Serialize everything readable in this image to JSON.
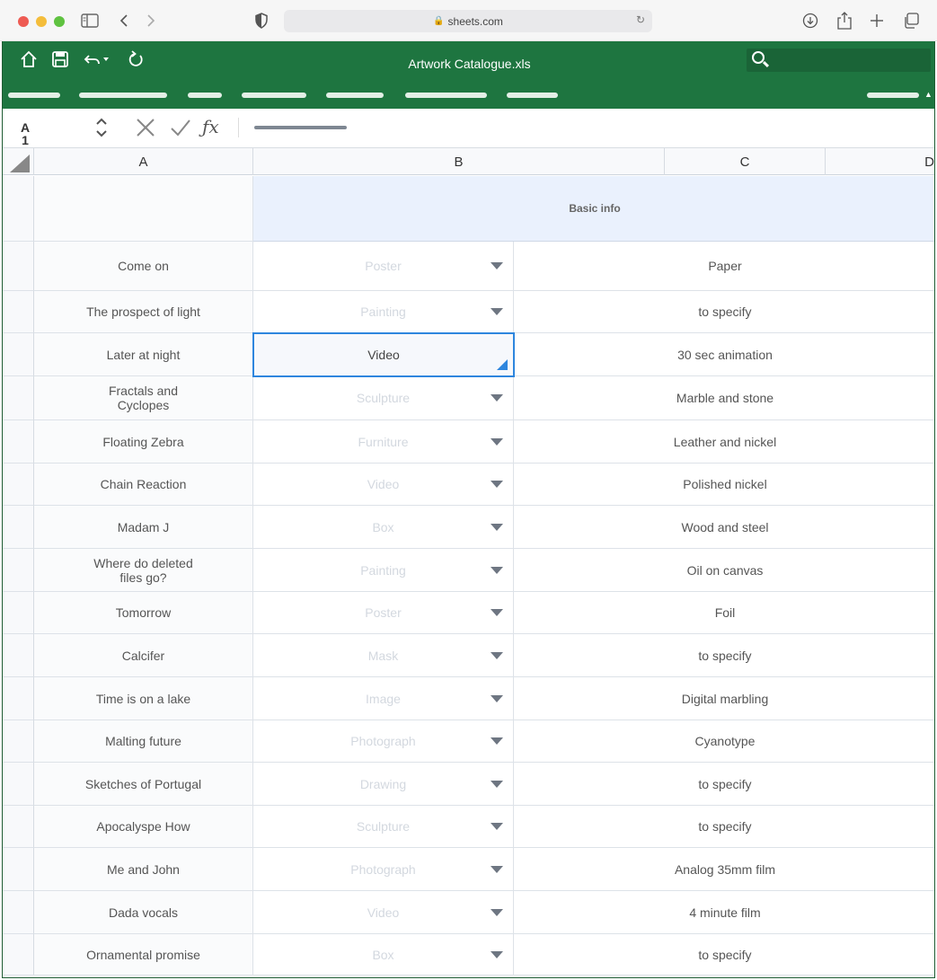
{
  "browser": {
    "url": "sheets.com"
  },
  "app": {
    "title": "Artwork Catalogue.xls",
    "selected_cell": "A1",
    "selected_cell_col": "A",
    "selected_cell_row": "1",
    "accent_color": "#1e7540",
    "selection_color": "#2e86de"
  },
  "columns": [
    "A",
    "B",
    "C",
    "D"
  ],
  "group_header": "Basic info",
  "rows": [
    {
      "title": "Come on",
      "type": "Poster",
      "material": "Paper"
    },
    {
      "title": "The prospect of light",
      "type": "Painting",
      "material": "to specify"
    },
    {
      "title": "Later at night",
      "type": "Video",
      "material": "30 sec animation"
    },
    {
      "title": "Fractals and\nCyclopes",
      "type": "Sculpture",
      "material": "Marble and stone"
    },
    {
      "title": "Floating Zebra",
      "type": "Furniture",
      "material": "Leather and nickel"
    },
    {
      "title": "Chain Reaction",
      "type": "Video",
      "material": "Polished nickel"
    },
    {
      "title": "Madam J",
      "type": "Box",
      "material": "Wood and steel"
    },
    {
      "title": "Where do deleted\nfiles go?",
      "type": "Painting",
      "material": "Oil on canvas"
    },
    {
      "title": "Tomorrow",
      "type": "Poster",
      "material": "Foil"
    },
    {
      "title": "Calcifer",
      "type": "Mask",
      "material": "to specify"
    },
    {
      "title": "Time is on a lake",
      "type": "Image",
      "material": "Digital marbling"
    },
    {
      "title": "Malting future",
      "type": "Photograph",
      "material": "Cyanotype"
    },
    {
      "title": "Sketches of Portugal",
      "type": "Drawing",
      "material": "to specify"
    },
    {
      "title": "Apocalyspe How",
      "type": "Sculpture",
      "material": "to specify"
    },
    {
      "title": "Me and John",
      "type": "Photograph",
      "material": "Analog 35mm film"
    },
    {
      "title": "Dada vocals",
      "type": "Video",
      "material": "4 minute film"
    },
    {
      "title": "Ornamental promise",
      "type": "Box",
      "material": "to specify"
    }
  ],
  "selected_row_index": 2
}
